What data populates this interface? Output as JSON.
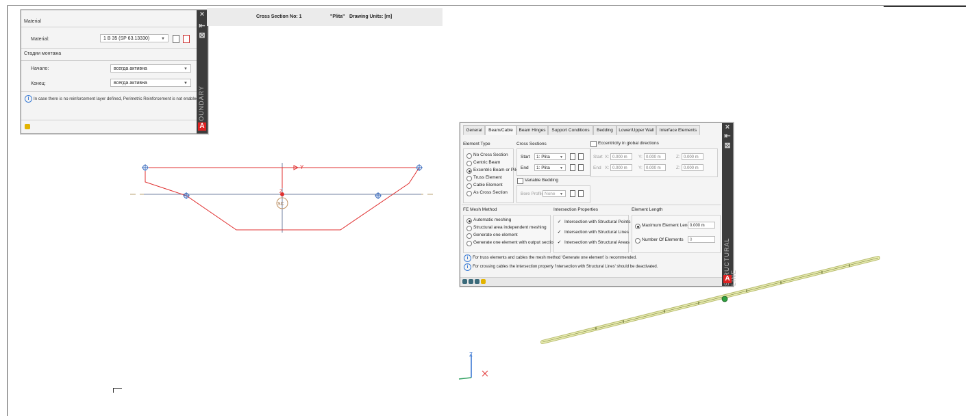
{
  "left_panel": {
    "section_material": "Material",
    "material_label": "Material:",
    "material_value": "1 B 35 (SP 63.13330)",
    "section_stages": "Стадии монтажа",
    "start_label": "Начало:",
    "start_value": "всегда активна",
    "end_label": "Конец:",
    "end_value": "всегда активна",
    "info_text": "In case there is no reinforcement layer defined, Perimetric Reinforcement is not enabled!",
    "side_title": "BOUNDARY",
    "close": "×",
    "pin": "⇤",
    "gear": "⊠",
    "logo": "A"
  },
  "cross_section": {
    "title": "Cross Section No: 1",
    "name": "\"Plita\"",
    "units": "Drawing Units: [m]",
    "y_label": "Y",
    "z_label": "Z",
    "sc_label": "SC"
  },
  "right_panel": {
    "tabs": [
      "General",
      "Beam/Cable",
      "Beam Hinges",
      "Support Conditions",
      "Bedding",
      "Lower/Upper Wall",
      "Interface Elements"
    ],
    "active_tab": "Beam/Cable",
    "element_type": {
      "title": "Element Type",
      "options": [
        "No Cross Section",
        "Centric Beam",
        "Excentric Beam or Pile",
        "Truss Element",
        "Cable Element",
        "As Cross Section"
      ],
      "selected": "Excentric Beam or Pile"
    },
    "cross_sections": {
      "title": "Cross Sections",
      "start_label": "Start",
      "start_value": "1: Plita",
      "end_label": "End",
      "end_value": "1: Plita",
      "variable_bedding": "Variable Bedding",
      "bore_profile_label": "Bore Profile",
      "bore_profile_value": "None"
    },
    "eccentricity": {
      "label": "Eccentricity in global directions",
      "start": "Start",
      "end": "End",
      "x": "X:",
      "y": "Y:",
      "z": "Z:",
      "value": "0.000 m"
    },
    "fe_mesh": {
      "title": "FE Mesh Method",
      "options": [
        "Automatic meshing",
        "Structural area independent meshing",
        "Generate one element",
        "Generate one element with output sections"
      ],
      "selected": "Automatic meshing"
    },
    "intersection": {
      "title": "Intersection Properties",
      "options": [
        "Intersection with Structural Points",
        "Intersection with Structural Lines",
        "Intersection with Structural Areas"
      ]
    },
    "element_length": {
      "title": "Element Length",
      "max_label": "Maximum Element Length",
      "max_value": "0.000 m",
      "num_label": "Number Of Elements",
      "num_value": "0"
    },
    "info1": "For truss elements and cables the mesh method 'Generate one element' is recommended.",
    "info2": "For crossing cables the intersection property 'Intersection with Structural Lines' should be deactivated.",
    "side_title": "STRUCTURAL LINE",
    "close": "×",
    "pin": "⇤",
    "gear": "⊠",
    "logo": "A"
  },
  "axis": {
    "z": "Z",
    "x": "X"
  },
  "colors": {
    "section_red": "#e03030",
    "axis_gray": "#7080a0",
    "beam_yellow": "#d8dc8c",
    "node_green": "#2fa040",
    "info_blue": "#3a7bd5"
  },
  "icons": [
    "info-icon",
    "copy-icon",
    "delete-icon",
    "edit-icon",
    "close-icon",
    "pin-icon",
    "settings-icon",
    "app-logo-icon"
  ]
}
